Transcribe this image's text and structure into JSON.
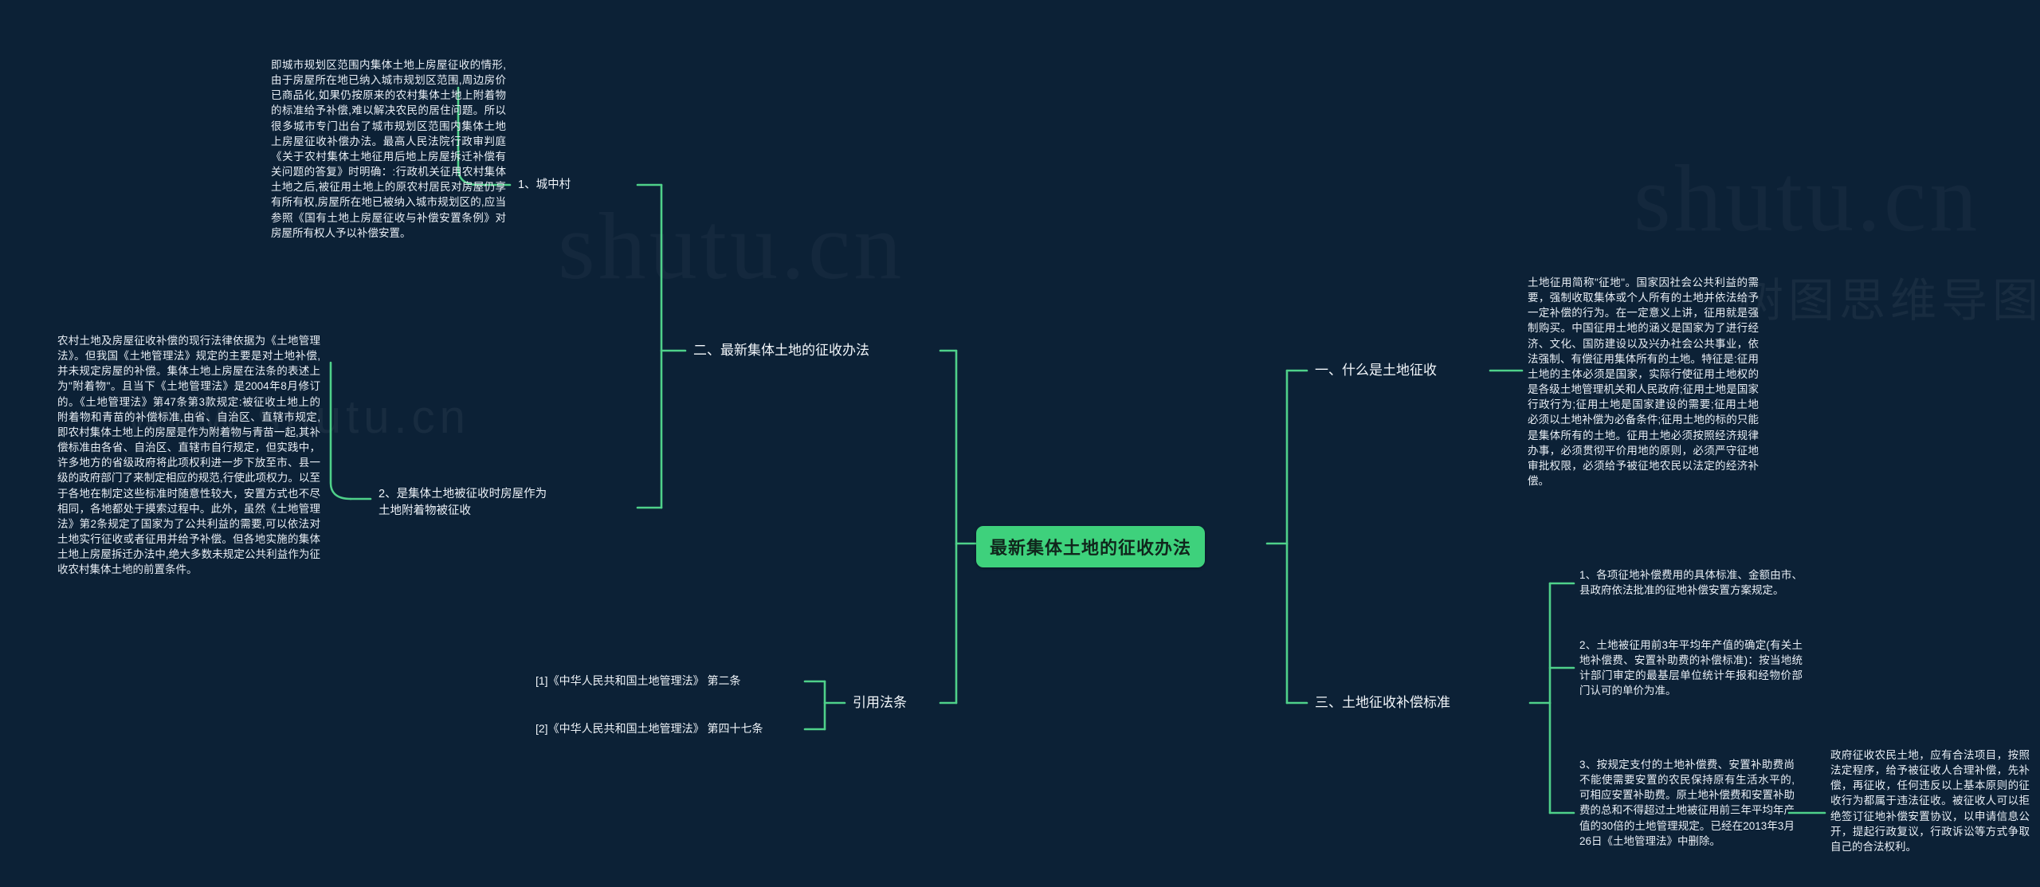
{
  "theme": {
    "background": "#0c2136",
    "accent": "#3ed17c",
    "link_color": "#4fd18a",
    "text_color": "#eef3f8",
    "root_text_color": "#10261c"
  },
  "watermarks": {
    "big_left": "shutu.cn",
    "big_right": "shutu.cn",
    "small_left": "www.shutu.cn",
    "small_right": "树图思维导图"
  },
  "root": {
    "label": "最新集体土地的征收办法"
  },
  "left_branches": [
    {
      "id": "branch-zuixin",
      "label": "二、最新集体土地的征收办法",
      "children": [
        {
          "id": "leaf-chengzhongcun",
          "label": "1、城中村",
          "detail": "即城市规划区范围内集体土地上房屋征收的情形,由于房屋所在地已纳入城市规划区范围,周边房价已商品化,如果仍按原来的农村集体土地上附着物的标准给予补偿,难以解决农民的居住问题。所以很多城市专门出台了城市规划区范围内集体土地上房屋征收补偿办法。最高人民法院行政审判庭《关于农村集体土地征用后地上房屋拆迁补偿有关问题的答复》时明确：:行政机关征用农村集体土地之后,被征用土地上的原农村居民对房屋仍享有所有权,房屋所在地已被纳入城市规划区的,应当参照《国有土地上房屋征收与补偿安置条例》对房屋所有权人予以补偿安置。"
        },
        {
          "id": "leaf-fangwu-fuzhuowu",
          "label": "2、是集体土地被征收时房屋作为土地附着物被征收",
          "detail": "农村土地及房屋征收补偿的现行法律依据为《土地管理法》。但我国《土地管理法》规定的主要是对土地补偿,并未规定房屋的补偿。集体土地上房屋在法条的表述上为\"附着物\"。且当下《土地管理法》是2004年8月修订的。《土地管理法》第47条第3款规定:被征收土地上的附着物和青苗的补偿标准,由省、自治区、直辖市规定,即农村集体土地上的房屋是作为附着物与青苗一起,其补偿标准由各省、自治区、直辖市自行规定，但实践中，许多地方的省级政府将此项权利进一步下放至市、县一级的政府部门了来制定相应的规范,行使此项权力。以至于各地在制定这些标准时随意性较大，安置方式也不尽相同，各地都处于摸索过程中。此外，虽然《土地管理法》第2条规定了国家为了公共利益的需要,可以依法对土地实行征收或者征用并给予补偿。但各地实施的集体土地上房屋拆迁办法中,绝大多数未规定公共利益作为征收农村集体土地的前置条件。"
        }
      ]
    },
    {
      "id": "branch-yinyong",
      "label": "引用法条",
      "children": [
        {
          "id": "cite-1",
          "label": "[1]《中华人民共和国土地管理法》 第二条"
        },
        {
          "id": "cite-2",
          "label": "[2]《中华人民共和国土地管理法》 第四十七条"
        }
      ]
    }
  ],
  "right_branches": [
    {
      "id": "branch-shenme",
      "label": "一、什么是土地征收",
      "children": [
        {
          "id": "leaf-dingyi",
          "detail": "土地征用简称\"征地\"。国家因社会公共利益的需要，强制收取集体或个人所有的土地并依法给予一定补偿的行为。在一定意义上讲，征用就是强制购买。中国征用土地的涵义是国家为了进行经济、文化、国防建设以及兴办社会公共事业，依法强制、有偿征用集体所有的土地。特征是:征用土地的主体必须是国家，实际行使征用土地权的是各级土地管理机关和人民政府;征用土地是国家行政行为;征用土地是国家建设的需要;征用土地必须以土地补偿为必备条件;征用土地的标的只能是集体所有的土地。征用土地必须按照经济规律办事，必须贯彻平价用地的原则，必须严守征地审批权限，必须给予被征地农民以法定的经济补偿。"
        }
      ]
    },
    {
      "id": "branch-buchang",
      "label": "三、土地征收补偿标准",
      "children": [
        {
          "id": "leaf-biaozhun-1",
          "detail": "1、各项征地补偿费用的具体标准、金额由市、县政府依法批准的征地补偿安置方案规定。"
        },
        {
          "id": "leaf-biaozhun-2",
          "detail": "2、土地被征用前3年平均年产值的确定(有关土地补偿费、安置补助费的补偿标准)：按当地统计部门审定的最基层单位统计年报和经物价部门认可的单价为准。"
        },
        {
          "id": "leaf-biaozhun-3",
          "detail": "3、按规定支付的土地补偿费、安置补助费尚不能使需要安置的农民保持原有生活水平的,可相应安置补助费。原土地补偿费和安置补助费的总和不得超过土地被征用前三年平均年产值的30倍的土地管理规定。已经在2013年3月26日《土地管理法》中删除。",
          "sibling_detail": "政府征收农民土地，应有合法项目，按照法定程序，给予被征收人合理补偿，先补偿，再征收，任何违反以上基本原则的征收行为都属于违法征收。被征收人可以拒绝签订征地补偿安置协议，以申请信息公开，提起行政复议，行政诉讼等方式争取自己的合法权利。"
        }
      ]
    }
  ]
}
